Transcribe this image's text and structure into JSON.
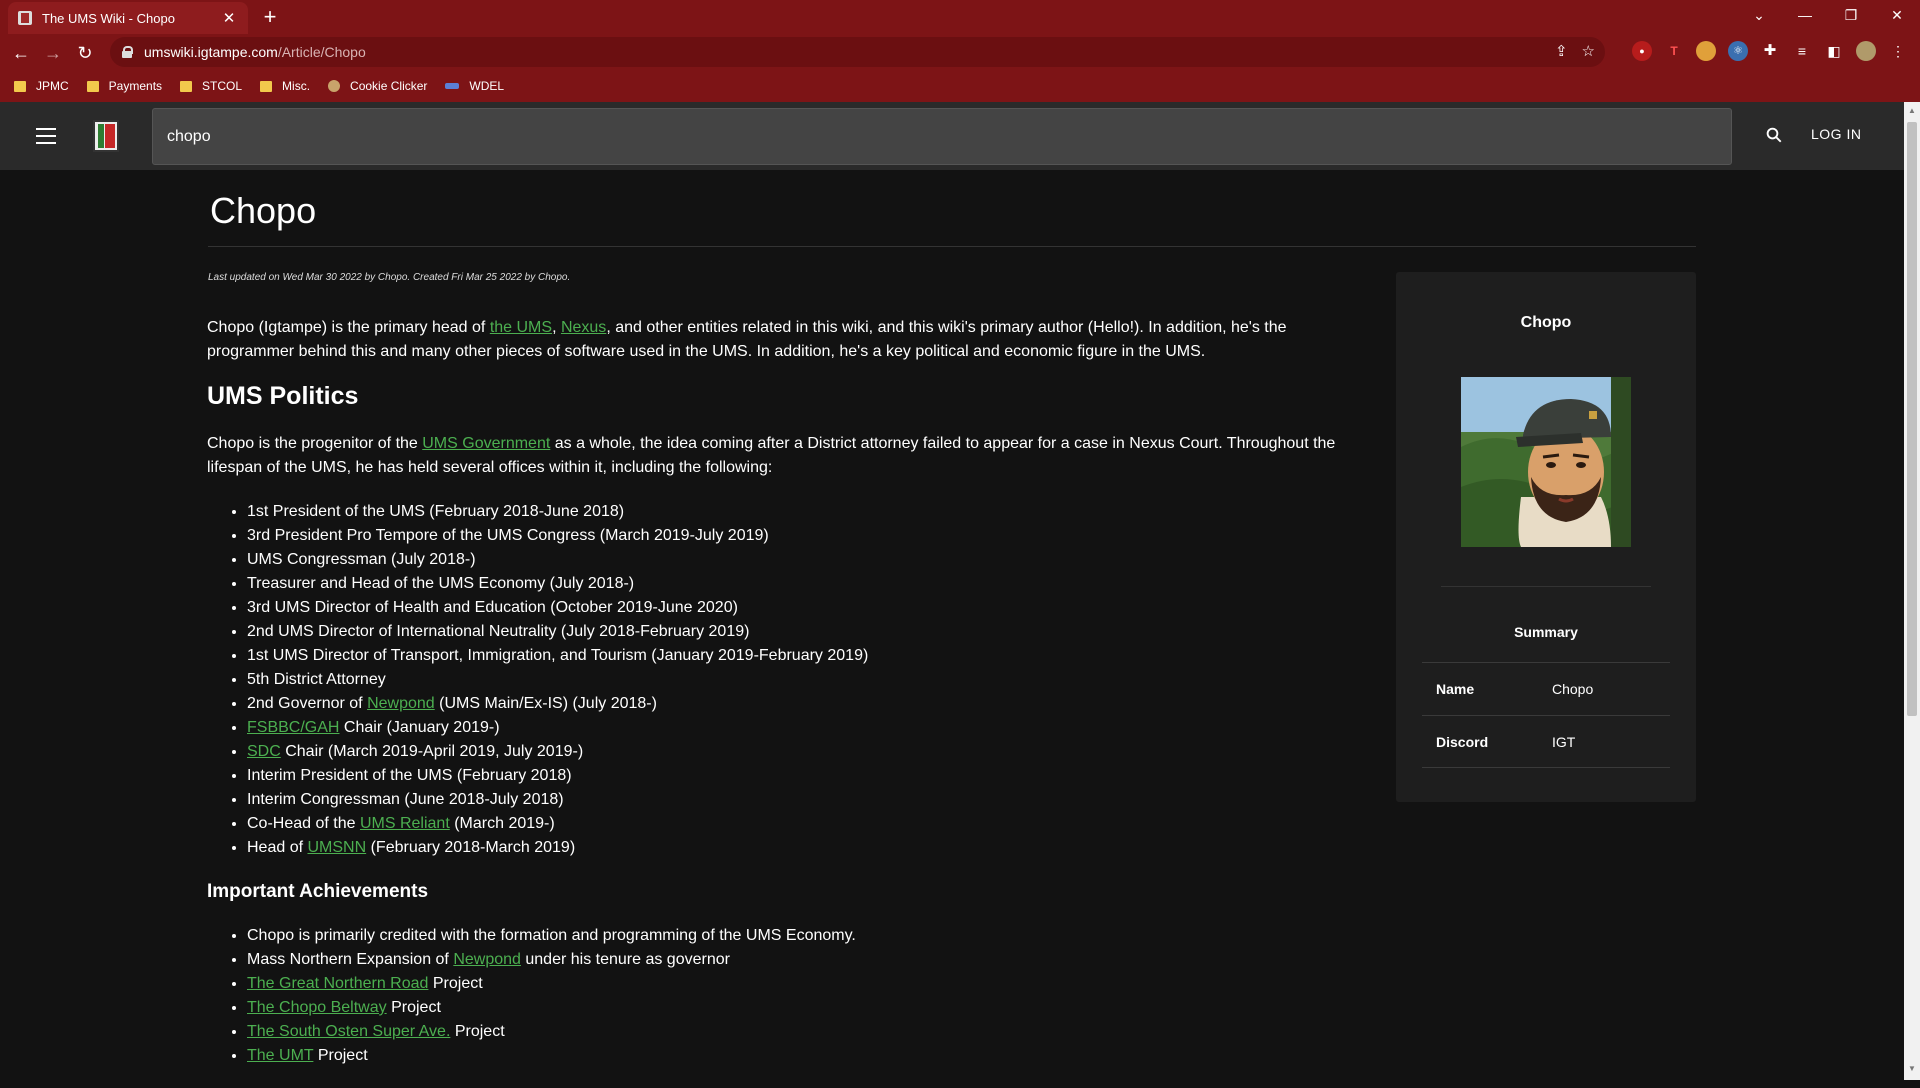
{
  "browser": {
    "tab_title": "The UMS Wiki - Chopo",
    "url_host": "umswiki.igtampe.com",
    "url_path": "/Article/Chopo",
    "bookmarks": [
      "JPMC",
      "Payments",
      "STCOL",
      "Misc.",
      "Cookie Clicker",
      "WDEL"
    ]
  },
  "appbar": {
    "search_value": "chopo",
    "login_label": "LOG IN"
  },
  "article": {
    "title": "Chopo",
    "meta": "Last updated on Wed Mar 30 2022 by Chopo. Created Fri Mar 25 2022 by Chopo.",
    "intro": {
      "t1": "Chopo (Igtampe) is the primary head of ",
      "l1": "the UMS",
      "t2": ", ",
      "l2": "Nexus",
      "t3": ", and other entities related in this wiki, and this wiki's primary author (Hello!). In addition, he's the programmer behind this and many other pieces of software used in the UMS. In addition, he's a key political and economic figure in the UMS."
    },
    "politics_heading": "UMS Politics",
    "politics_intro": {
      "t1": "Chopo is the progenitor of the ",
      "l1": "UMS Government",
      "t2": " as a whole, the idea coming after a District attorney failed to appear for a case in Nexus Court. Throughout the lifespan of the UMS, he has held several offices within it, including the following:"
    },
    "offices": {
      "o1": "1st President of the UMS (February 2018-June 2018)",
      "o2": "3rd President Pro Tempore of the UMS Congress (March 2019-July 2019)",
      "o3": "UMS Congressman (July 2018-)",
      "o4": "Treasurer and Head of the UMS Economy (July 2018-)",
      "o5": "3rd UMS Director of Health and Education (October 2019-June 2020)",
      "o6": "2nd UMS Director of International Neutrality (July 2018-February 2019)",
      "o7": "1st UMS Director of Transport, Immigration, and Tourism (January 2019-February 2019)",
      "o8": "5th District Attorney",
      "o9_pre": "2nd Governor of ",
      "o9_link": "Newpond",
      "o9_post": " (UMS Main/Ex-IS) (July 2018-)",
      "o10_link": "FSBBC/GAH",
      "o10_post": " Chair (January 2019-)",
      "o11_link": "SDC",
      "o11_post": " Chair (March 2019-April 2019, July 2019-)",
      "o12": "Interim President of the UMS (February 2018)",
      "o13": "Interim Congressman (June 2018-July 2018)",
      "o14_pre": "Co-Head of the ",
      "o14_link": "UMS Reliant",
      "o14_post": " (March 2019-)",
      "o15_pre": "Head of ",
      "o15_link": "UMSNN",
      "o15_post": " (February 2018-March 2019)"
    },
    "achievements_heading": "Important Achievements",
    "achievements": {
      "a1": "Chopo is primarily credited with the formation and programming of the UMS Economy.",
      "a2_pre": "Mass Northern Expansion of ",
      "a2_link": "Newpond",
      "a2_post": " under his tenure as governor",
      "a3_link": "The Great Northern Road",
      "a3_post": " Project",
      "a4_link": "The Chopo Beltway",
      "a4_post": " Project",
      "a5_link": "The South Osten Super Ave.",
      "a5_post": " Project",
      "a6_link": "The UMT",
      "a6_post": " Project"
    }
  },
  "infobox": {
    "name": "Chopo",
    "summary_heading": "Summary",
    "rows": [
      {
        "key": "Name",
        "value": "Chopo"
      },
      {
        "key": "Discord",
        "value": "IGT"
      }
    ]
  },
  "colors": {
    "browser_chrome": "#7d1416",
    "appbar": "#2a2a2a",
    "page_bg": "#121212",
    "link": "#4caf50"
  }
}
